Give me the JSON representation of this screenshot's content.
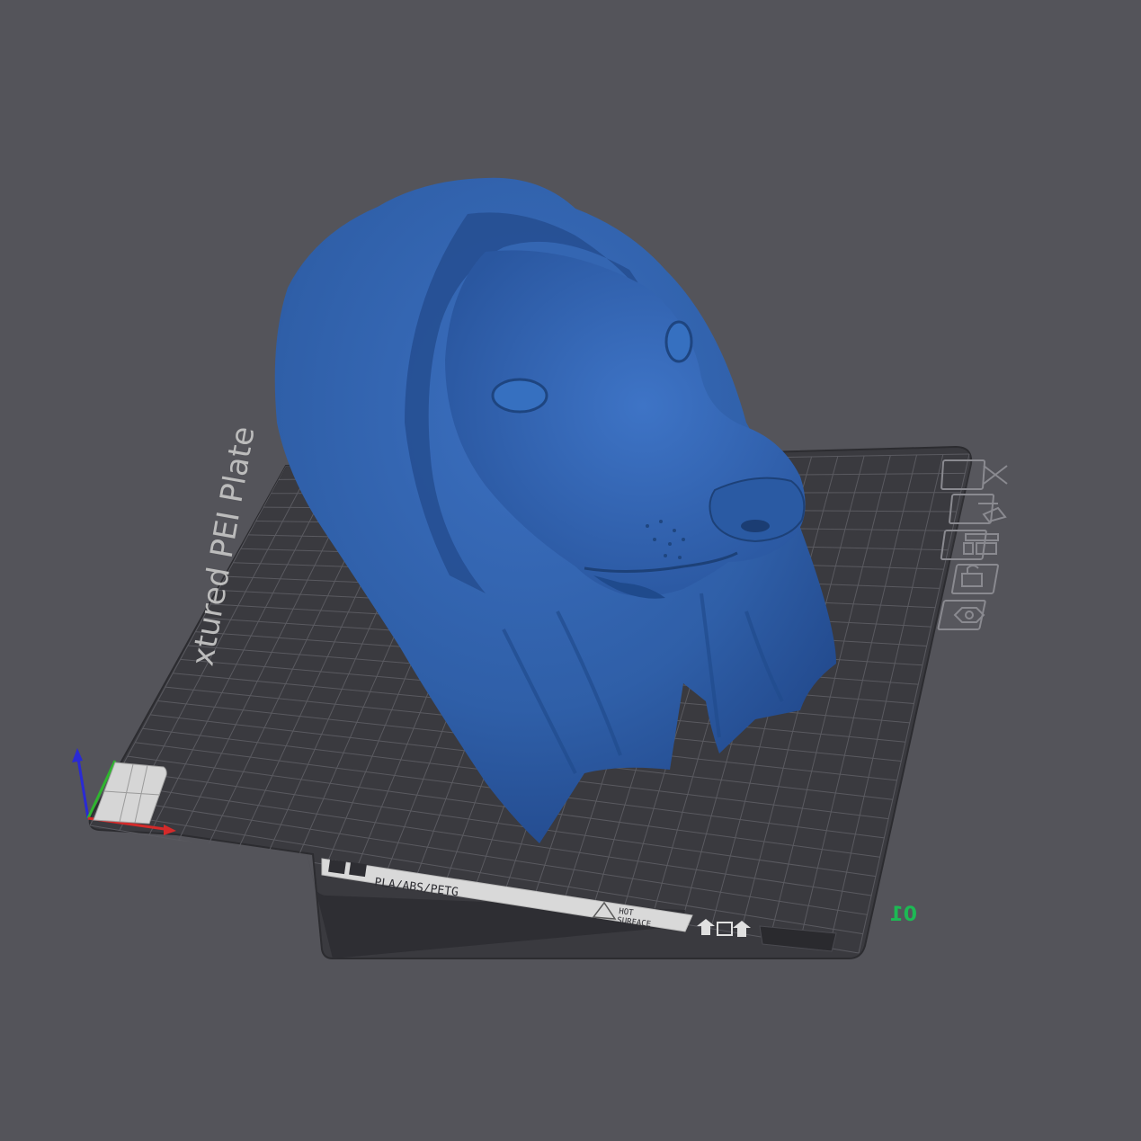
{
  "viewport": {
    "background": "#54545a",
    "plate": {
      "name": "Textured PEI Plate",
      "visible_name_fragment": "xtured PEI Plate",
      "materials": "PLA/ABS/PETG",
      "warning_line1": "HOT",
      "warning_line2": "SURFACE",
      "plate_number": "01",
      "plate_color": "#3a3a3f",
      "grid_color": "#5a5a60",
      "accent_green": "#1db954"
    },
    "model": {
      "description": "dog head in hood",
      "color": "#2f5fa8"
    },
    "axes": {
      "x_color": "#d42a2a",
      "y_color": "#2fb52f",
      "z_color": "#2a2ad4"
    },
    "plate_toolbar": [
      {
        "icon": "close-icon",
        "action": "remove plate"
      },
      {
        "icon": "auto-orient-icon",
        "action": "auto orient"
      },
      {
        "icon": "arrange-icon",
        "action": "arrange"
      },
      {
        "icon": "lock-icon",
        "action": "lock plate"
      },
      {
        "icon": "plate-settings-icon",
        "action": "plate settings"
      }
    ]
  }
}
